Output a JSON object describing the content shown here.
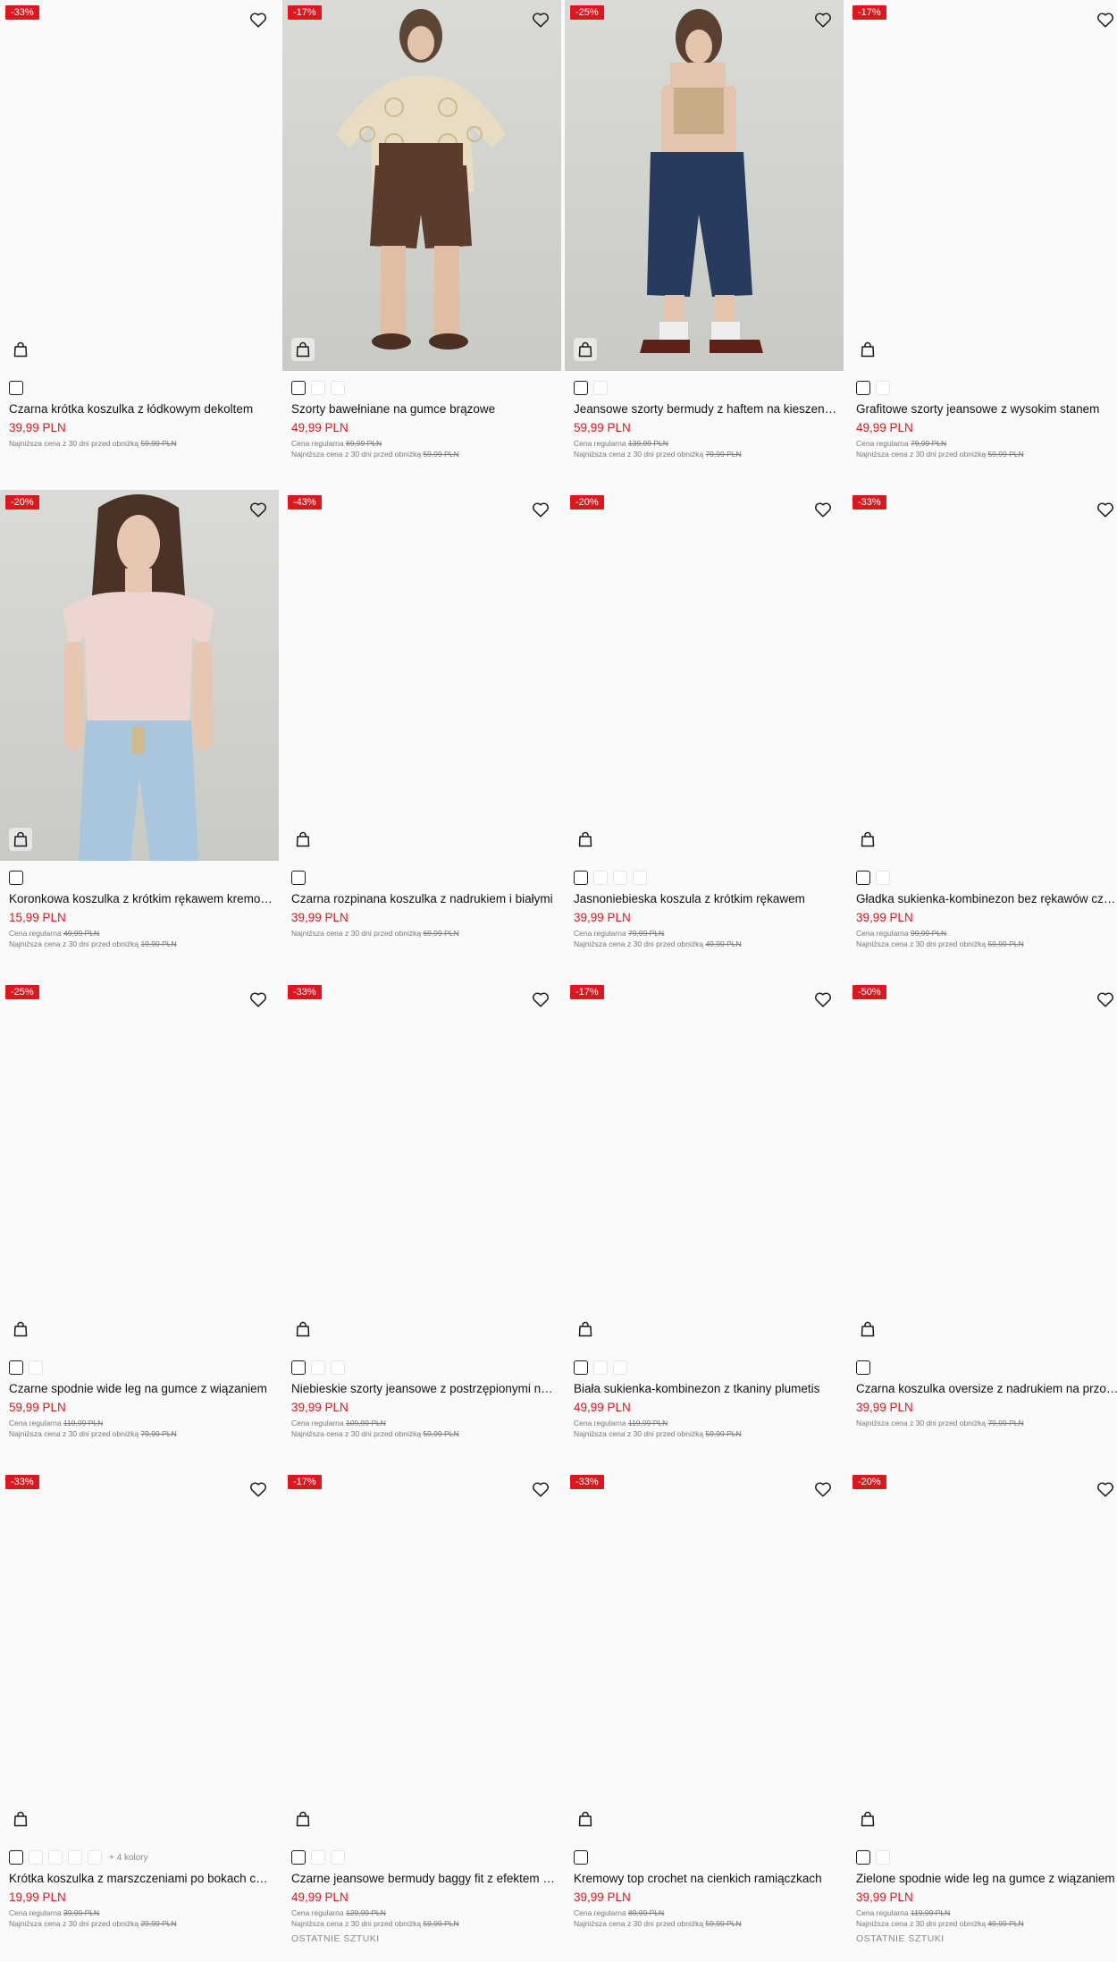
{
  "labels": {
    "regular_prefix": "Cena regularna",
    "lowest_prefix": "Najniższa cena z 30 dni przed obniżką"
  },
  "colors": {
    "badge": "#e3141b",
    "price": "#e3141b"
  },
  "products": [
    {
      "badge": "-33%",
      "name": "Czarna krótka koszulka z łódkowym dekoltem",
      "price": "39,99 PLN",
      "regular": "",
      "lowest": "59,99 PLN",
      "swatches": [
        "black"
      ],
      "more": "",
      "note": ""
    },
    {
      "badge": "-17%",
      "name": "Szorty bawełniane na gumce brązowe",
      "price": "49,99 PLN",
      "regular": "69,99 PLN",
      "lowest": "59,99 PLN",
      "swatches": [
        "black",
        "white",
        "white"
      ],
      "more": "",
      "note": ""
    },
    {
      "badge": "-25%",
      "name": "Jeansowe szorty bermudy z haftem na kieszeniach",
      "price": "59,99 PLN",
      "regular": "139,99 PLN",
      "lowest": "79,99 PLN",
      "swatches": [
        "black",
        "white"
      ],
      "more": "",
      "note": ""
    },
    {
      "badge": "-17%",
      "name": "Grafitowe szorty jeansowe z wysokim stanem",
      "price": "49,99 PLN",
      "regular": "79,99 PLN",
      "lowest": "59,99 PLN",
      "swatches": [
        "black",
        "white"
      ],
      "more": "",
      "note": ""
    },
    {
      "badge": "-20%",
      "name": "Koronkowa koszulka z krótkim rękawem kremowa",
      "price": "15,99 PLN",
      "regular": "49,99 PLN",
      "lowest": "19,99 PLN",
      "swatches": [
        "black"
      ],
      "more": "",
      "note": ""
    },
    {
      "badge": "-43%",
      "name": "Czarna rozpinana koszulka z nadrukiem i białymi",
      "price": "39,99 PLN",
      "regular": "",
      "lowest": "69,99 PLN",
      "swatches": [
        "black"
      ],
      "more": "",
      "note": ""
    },
    {
      "badge": "-20%",
      "name": "Jasnoniebieska koszula z krótkim rękawem",
      "price": "39,99 PLN",
      "regular": "79,99 PLN",
      "lowest": "49,99 PLN",
      "swatches": [
        "black",
        "white",
        "white",
        "white"
      ],
      "more": "",
      "note": ""
    },
    {
      "badge": "-33%",
      "name": "Gładka sukienka-kombinezon bez rękawów czarna",
      "price": "39,99 PLN",
      "regular": "99,99 PLN",
      "lowest": "59,99 PLN",
      "swatches": [
        "black",
        "white"
      ],
      "more": "",
      "note": ""
    },
    {
      "badge": "-25%",
      "name": "Czarne spodnie wide leg na gumce z wiązaniem",
      "price": "59,99 PLN",
      "regular": "119,99 PLN",
      "lowest": "79,99 PLN",
      "swatches": [
        "black",
        "white"
      ],
      "more": "",
      "note": ""
    },
    {
      "badge": "-33%",
      "name": "Niebieskie szorty jeansowe z postrzępionymi nogawkami",
      "price": "39,99 PLN",
      "regular": "109,99 PLN",
      "lowest": "59,99 PLN",
      "swatches": [
        "black",
        "white",
        "white"
      ],
      "more": "",
      "note": ""
    },
    {
      "badge": "-17%",
      "name": "Biała sukienka-kombinezon z tkaniny plumetis",
      "price": "49,99 PLN",
      "regular": "119,99 PLN",
      "lowest": "59,99 PLN",
      "swatches": [
        "black",
        "white",
        "white"
      ],
      "more": "",
      "note": ""
    },
    {
      "badge": "-50%",
      "name": "Czarna koszulka oversize z nadrukiem na przodzie",
      "price": "39,99 PLN",
      "regular": "",
      "lowest": "79,99 PLN",
      "swatches": [
        "black"
      ],
      "more": "",
      "note": ""
    },
    {
      "badge": "-33%",
      "name": "Krótka koszulka z marszczeniami po bokach czarna",
      "price": "19,99 PLN",
      "regular": "39,99 PLN",
      "lowest": "29,99 PLN",
      "swatches": [
        "black",
        "white",
        "white",
        "white",
        "white"
      ],
      "more": "+ 4 kolory",
      "note": ""
    },
    {
      "badge": "-17%",
      "name": "Czarne jeansowe bermudy baggy fit z efektem sprania",
      "price": "49,99 PLN",
      "regular": "129,99 PLN",
      "lowest": "59,99 PLN",
      "swatches": [
        "black",
        "white",
        "white"
      ],
      "more": "",
      "note": "OSTATNIE SZTUKI"
    },
    {
      "badge": "-33%",
      "name": "Kremowy top crochet na cienkich ramiączkach",
      "price": "39,99 PLN",
      "regular": "89,99 PLN",
      "lowest": "59,99 PLN",
      "swatches": [
        "black"
      ],
      "more": "",
      "note": ""
    },
    {
      "badge": "-20%",
      "name": "Zielone spodnie wide leg na gumce z wiązaniem",
      "price": "39,99 PLN",
      "regular": "119,99 PLN",
      "lowest": "49,99 PLN",
      "swatches": [
        "black",
        "white"
      ],
      "more": "",
      "note": "OSTATNIE SZTUKI"
    }
  ],
  "photos": {
    "1": "crochet-cardigan-brown-shorts",
    "2": "strapless-top-denim-bermuda",
    "4": "lace-top-light-jeans"
  }
}
